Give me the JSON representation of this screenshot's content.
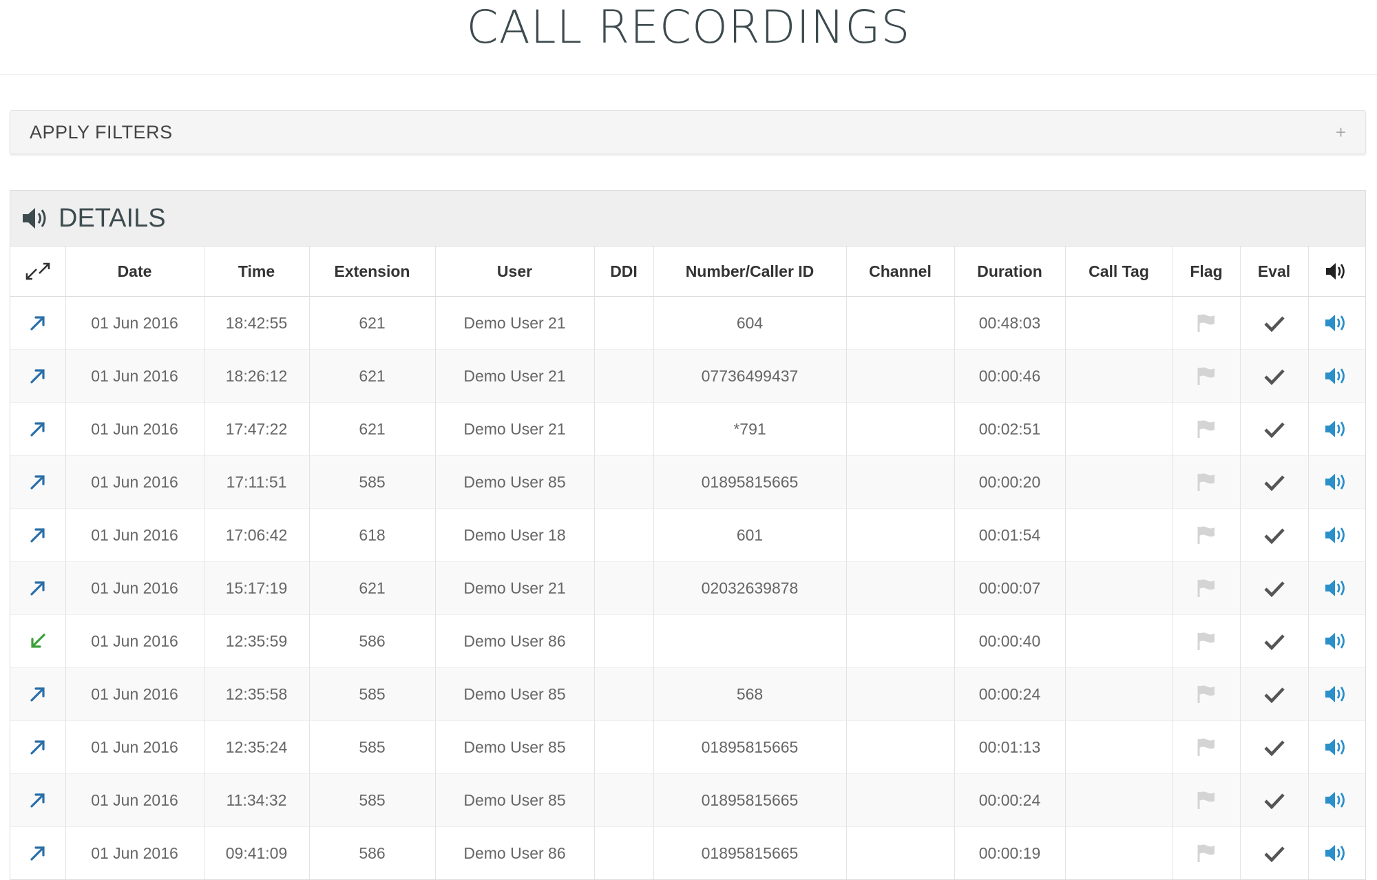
{
  "page": {
    "title": "CALL RECORDINGS"
  },
  "filters": {
    "label": "APPLY FILTERS",
    "toggle": "+"
  },
  "details": {
    "title": "DETAILS",
    "columns": [
      "Date",
      "Time",
      "Extension",
      "User",
      "DDI",
      "Number/Caller ID",
      "Channel",
      "Duration",
      "Call Tag",
      "Flag",
      "Eval"
    ],
    "rows": [
      {
        "direction": "outbound",
        "date": "01 Jun 2016",
        "time": "18:42:55",
        "extension": "621",
        "user": "Demo User 21",
        "ddi": "",
        "number": "604",
        "channel": "",
        "duration": "00:48:03",
        "call_tag": ""
      },
      {
        "direction": "outbound",
        "date": "01 Jun 2016",
        "time": "18:26:12",
        "extension": "621",
        "user": "Demo User 21",
        "ddi": "",
        "number": "07736499437",
        "channel": "",
        "duration": "00:00:46",
        "call_tag": ""
      },
      {
        "direction": "outbound",
        "date": "01 Jun 2016",
        "time": "17:47:22",
        "extension": "621",
        "user": "Demo User 21",
        "ddi": "",
        "number": "*791",
        "channel": "",
        "duration": "00:02:51",
        "call_tag": ""
      },
      {
        "direction": "outbound",
        "date": "01 Jun 2016",
        "time": "17:11:51",
        "extension": "585",
        "user": "Demo User 85",
        "ddi": "",
        "number": "01895815665",
        "channel": "",
        "duration": "00:00:20",
        "call_tag": ""
      },
      {
        "direction": "outbound",
        "date": "01 Jun 2016",
        "time": "17:06:42",
        "extension": "618",
        "user": "Demo User 18",
        "ddi": "",
        "number": "601",
        "channel": "",
        "duration": "00:01:54",
        "call_tag": ""
      },
      {
        "direction": "outbound",
        "date": "01 Jun 2016",
        "time": "15:17:19",
        "extension": "621",
        "user": "Demo User 21",
        "ddi": "",
        "number": "02032639878",
        "channel": "",
        "duration": "00:00:07",
        "call_tag": ""
      },
      {
        "direction": "inbound",
        "date": "01 Jun 2016",
        "time": "12:35:59",
        "extension": "586",
        "user": "Demo User 86",
        "ddi": "",
        "number": "",
        "channel": "",
        "duration": "00:00:40",
        "call_tag": ""
      },
      {
        "direction": "outbound",
        "date": "01 Jun 2016",
        "time": "12:35:58",
        "extension": "585",
        "user": "Demo User 85",
        "ddi": "",
        "number": "568",
        "channel": "",
        "duration": "00:00:24",
        "call_tag": ""
      },
      {
        "direction": "outbound",
        "date": "01 Jun 2016",
        "time": "12:35:24",
        "extension": "585",
        "user": "Demo User 85",
        "ddi": "",
        "number": "01895815665",
        "channel": "",
        "duration": "00:01:13",
        "call_tag": ""
      },
      {
        "direction": "outbound",
        "date": "01 Jun 2016",
        "time": "11:34:32",
        "extension": "585",
        "user": "Demo User 85",
        "ddi": "",
        "number": "01895815665",
        "channel": "",
        "duration": "00:00:24",
        "call_tag": ""
      },
      {
        "direction": "outbound",
        "date": "01 Jun 2016",
        "time": "09:41:09",
        "extension": "586",
        "user": "Demo User 86",
        "ddi": "",
        "number": "01895815665",
        "channel": "",
        "duration": "00:00:19",
        "call_tag": ""
      }
    ]
  },
  "icons": {
    "direction_header": "call-direction-icon",
    "outbound": "arrow-up-right-icon",
    "inbound": "arrow-down-left-icon",
    "flag": "flag-icon",
    "eval": "check-icon",
    "play": "speaker-icon"
  },
  "colors": {
    "outbound_arrow": "#2a6fa8",
    "inbound_arrow": "#3aa03a",
    "play_icon": "#2b8fc9",
    "flag_icon": "#d4d4d4",
    "check_icon": "#555555",
    "title_text": "#3d4b4f"
  }
}
